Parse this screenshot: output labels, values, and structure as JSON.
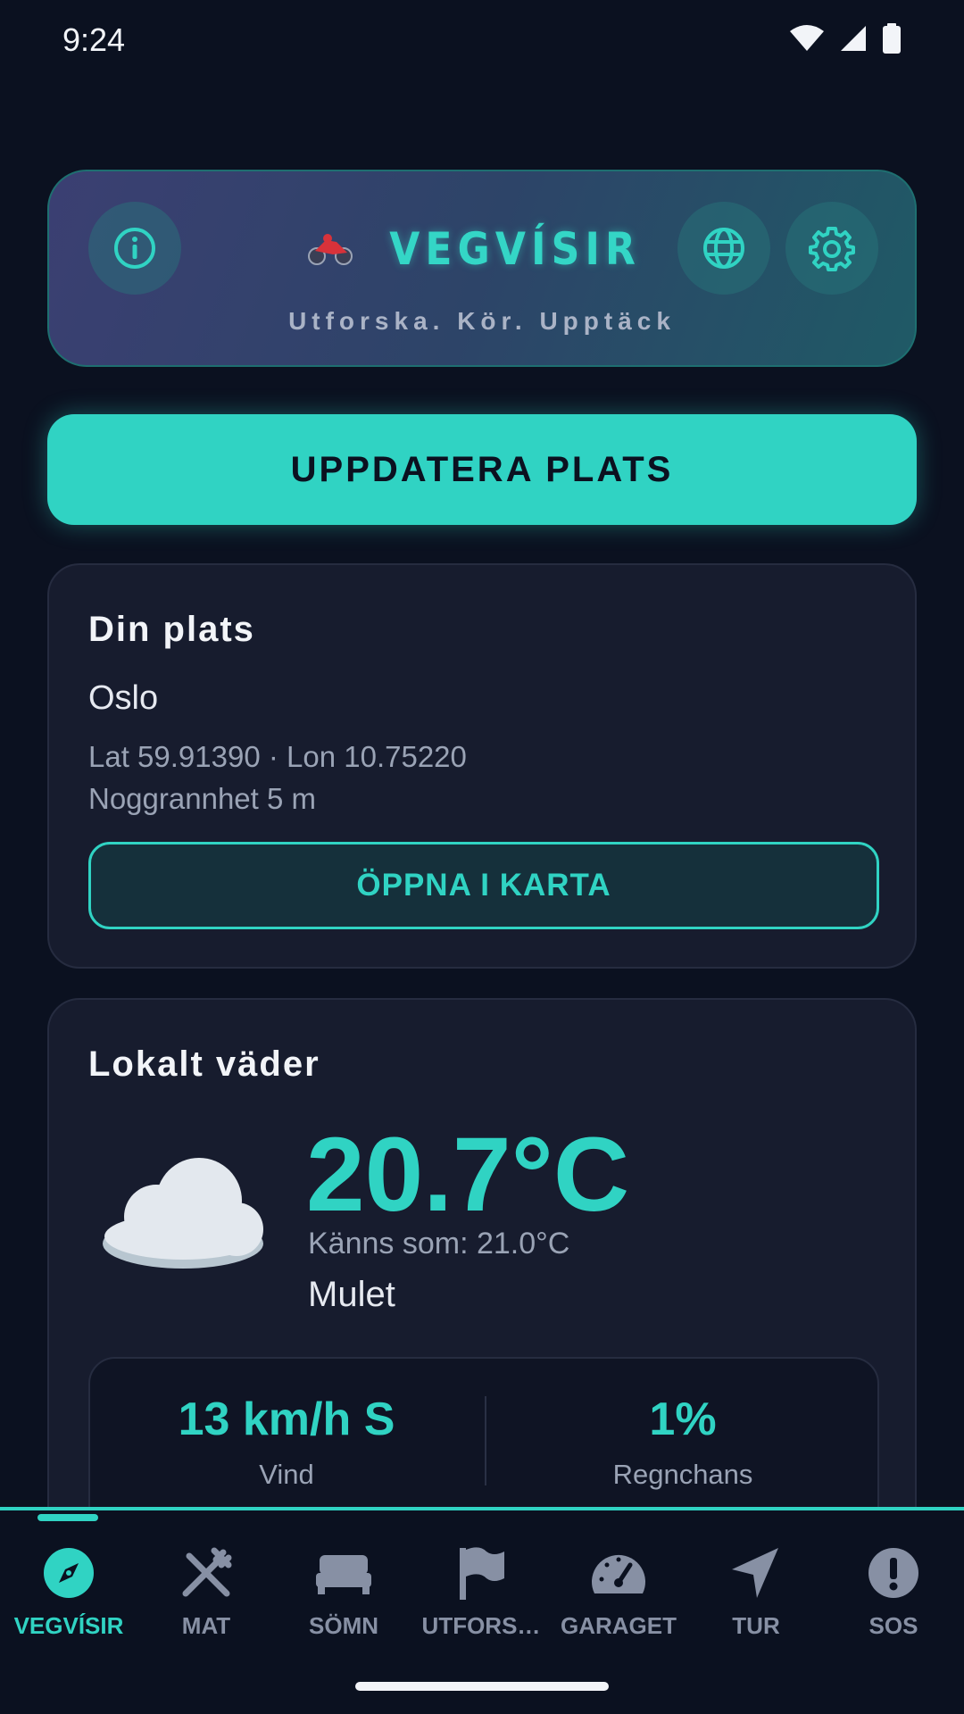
{
  "status": {
    "time": "9:24"
  },
  "header": {
    "title": "VEGVÍSIR",
    "tagline": "Utforska. Kör. Upptäck",
    "logo_emoji": "🏍️",
    "info_icon": "info-icon",
    "language_icon": "globe-icon",
    "settings_icon": "gear-icon"
  },
  "update_button": {
    "label": "UPPDATERA PLATS"
  },
  "location": {
    "title": "Din plats",
    "city": "Oslo",
    "coords": "Lat 59.91390 · Lon 10.75220",
    "accuracy": "Noggrannhet 5 m",
    "map_button": "ÖPPNA I KARTA"
  },
  "weather": {
    "title": "Lokalt väder",
    "temperature": "20.7°C",
    "feels_like": "Känns som: 21.0°C",
    "condition": "Mulet",
    "icon": "cloud-icon",
    "wind_value": "13 km/h S",
    "wind_label": "Vind",
    "rain_value": "1%",
    "rain_label": "Regnchans"
  },
  "nav": {
    "active": "VEGVÍSIR",
    "items": [
      {
        "label": "VEGVÍSIR",
        "icon": "compass-icon"
      },
      {
        "label": "MAT",
        "icon": "utensils-icon"
      },
      {
        "label": "SÖMN",
        "icon": "bed-icon"
      },
      {
        "label": "UTFORS…",
        "icon": "flag-icon"
      },
      {
        "label": "GARAGET",
        "icon": "speedometer-icon"
      },
      {
        "label": "TUR",
        "icon": "navigation-arrow-icon"
      },
      {
        "label": "SOS",
        "icon": "alert-icon"
      }
    ]
  },
  "colors": {
    "accent": "#30d3c3",
    "background": "#0b1120",
    "card": "#171c2e"
  }
}
